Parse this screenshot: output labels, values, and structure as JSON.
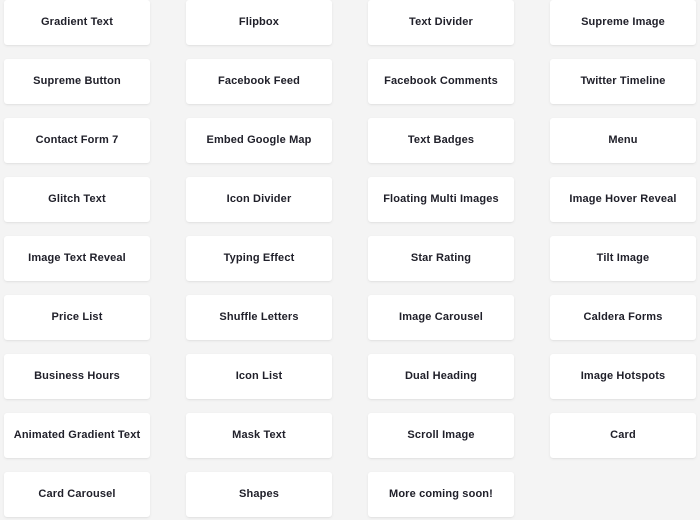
{
  "theme": {
    "background": "#f4f4f4",
    "card_background": "#ffffff",
    "label_color": "#20202a"
  },
  "grid": {
    "columns": 4,
    "rows": 9,
    "total_cards": 35
  },
  "cards": [
    {
      "label": "Gradient Text"
    },
    {
      "label": "Flipbox"
    },
    {
      "label": "Text Divider"
    },
    {
      "label": "Supreme Image"
    },
    {
      "label": "Supreme Button"
    },
    {
      "label": "Facebook Feed"
    },
    {
      "label": "Facebook Comments"
    },
    {
      "label": "Twitter Timeline"
    },
    {
      "label": "Contact Form 7"
    },
    {
      "label": "Embed Google Map"
    },
    {
      "label": "Text Badges"
    },
    {
      "label": "Menu"
    },
    {
      "label": "Glitch Text"
    },
    {
      "label": "Icon Divider"
    },
    {
      "label": "Floating Multi Images"
    },
    {
      "label": "Image Hover Reveal"
    },
    {
      "label": "Image Text Reveal"
    },
    {
      "label": "Typing Effect"
    },
    {
      "label": "Star Rating"
    },
    {
      "label": "Tilt Image"
    },
    {
      "label": "Price List"
    },
    {
      "label": "Shuffle Letters"
    },
    {
      "label": "Image Carousel"
    },
    {
      "label": "Caldera Forms"
    },
    {
      "label": "Business Hours"
    },
    {
      "label": "Icon List"
    },
    {
      "label": "Dual Heading"
    },
    {
      "label": "Image Hotspots"
    },
    {
      "label": "Animated Gradient Text"
    },
    {
      "label": "Mask Text"
    },
    {
      "label": "Scroll Image"
    },
    {
      "label": "Card"
    },
    {
      "label": "Card Carousel"
    },
    {
      "label": "Shapes"
    },
    {
      "label": "More coming soon!"
    }
  ]
}
